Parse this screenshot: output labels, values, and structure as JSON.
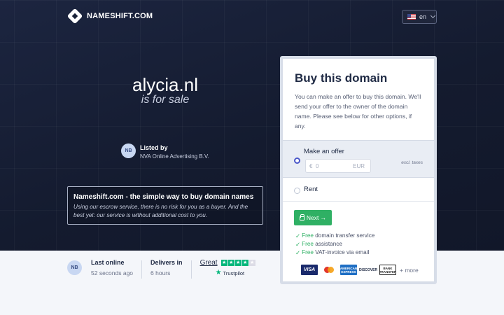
{
  "brand": {
    "name": "NAMESHIFT.COM"
  },
  "language": {
    "code": "en"
  },
  "hero": {
    "domain": "alycia.nl",
    "subtitle": "is for sale"
  },
  "seller": {
    "initials": "NB",
    "label": "Listed by",
    "name": "NVA Online Advertising B.V."
  },
  "info": {
    "title": "Nameshift.com - the simple way to buy domain names",
    "text": "Using our escrow service, there is no risk for you as a buyer. And the best yet: our service is without additional cost to you."
  },
  "stats": {
    "initials": "NB",
    "last_online_label": "Last online",
    "last_online_value": "52 seconds ago",
    "delivers_label": "Delivers in",
    "delivers_value": "6 hours"
  },
  "trustpilot": {
    "rating_word": "Great",
    "stars_filled": 4,
    "stars_total": 5,
    "brand": "Trustpilot"
  },
  "card": {
    "title": "Buy this domain",
    "description": "You can make an offer to buy this domain. We'll send your offer to the owner of the domain name. Please see below for other options, if any.",
    "offer_label": "Make an offer",
    "offer_prefix": "€",
    "offer_placeholder": "0",
    "offer_currency": "EUR",
    "excl_taxes": "excl. taxes",
    "rent_label": "Rent",
    "next_label": "Next →",
    "features": [
      {
        "free": "Free",
        "text": " domain transfer service"
      },
      {
        "free": "Free",
        "text": " assistance"
      },
      {
        "free": "Free",
        "text": " VAT-invoice via email"
      }
    ],
    "payments": {
      "visa": "VISA",
      "amex": "AMERICAN EXPRESS",
      "discover": "DISCOVER",
      "bank": "BANK TRANSFER",
      "more": "+ more"
    }
  },
  "colors": {
    "accent_green": "#2fb064",
    "radio_blue": "#4a57c9",
    "hero_bg": "#1a2238"
  }
}
